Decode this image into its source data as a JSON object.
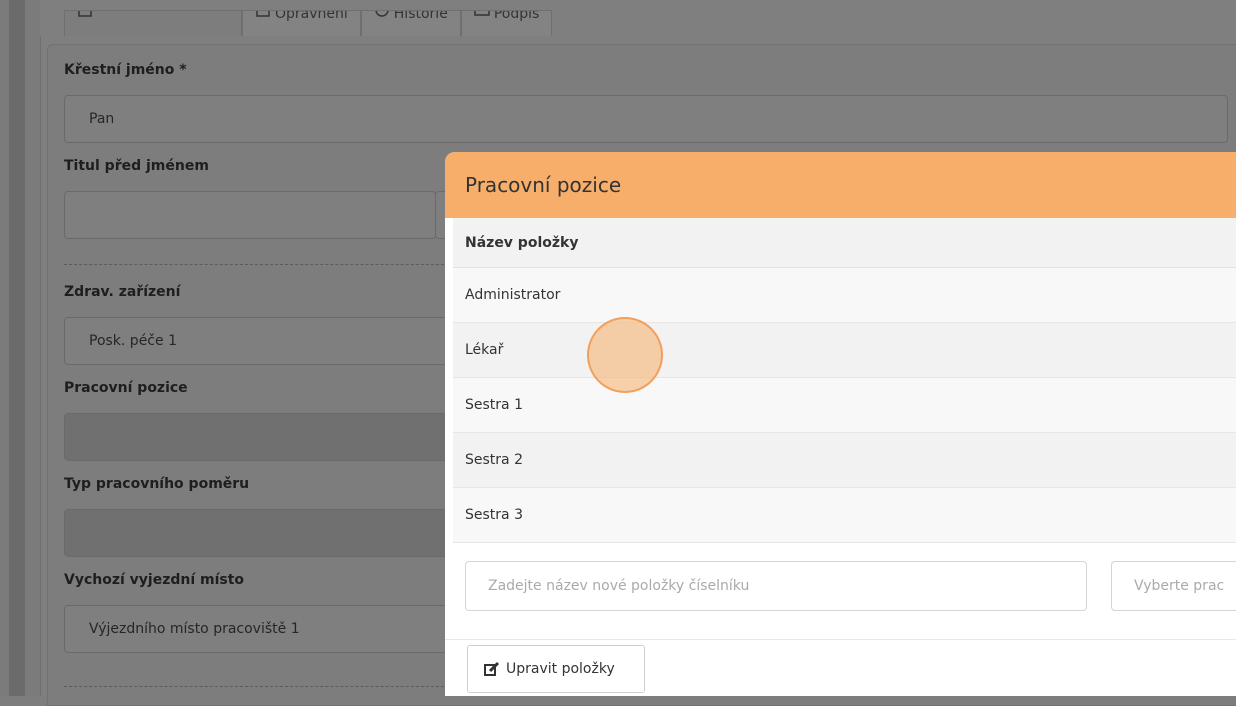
{
  "tabs": [
    {
      "label": "",
      "icon": "user-icon"
    },
    {
      "label": "Oprávnění",
      "icon": "checkbox-icon"
    },
    {
      "label": "Historie",
      "icon": "history-icon"
    },
    {
      "label": "Podpis",
      "icon": "image-icon"
    }
  ],
  "form": {
    "first_name": {
      "label": "Křestní jméno *",
      "value": "Pan"
    },
    "title_before": {
      "label": "Titul před jménem",
      "value": ""
    },
    "facility": {
      "label": "Zdrav. zařízení",
      "value": "Posk. péče 1"
    },
    "position": {
      "label": "Pracovní pozice",
      "value": ""
    },
    "employment_type": {
      "label": "Typ pracovního poměru",
      "value": ""
    },
    "departure_place": {
      "label": "Vychozí vyjezdní místo",
      "value": "Výjezdního místo pracoviště 1"
    }
  },
  "modal": {
    "title": "Pracovní pozice",
    "column_header": "Název položky",
    "rows": [
      "Administrator",
      "Lékař",
      "Sestra 1",
      "Sestra 2",
      "Sestra 3"
    ],
    "new_item_placeholder": "Zadejte název nové položky číselníku",
    "select_placeholder": "Vyberte prac",
    "edit_button": "Upravit položky"
  },
  "colors": {
    "modal_header": "#f6ae6a",
    "cursor": "#f6ae6a"
  }
}
